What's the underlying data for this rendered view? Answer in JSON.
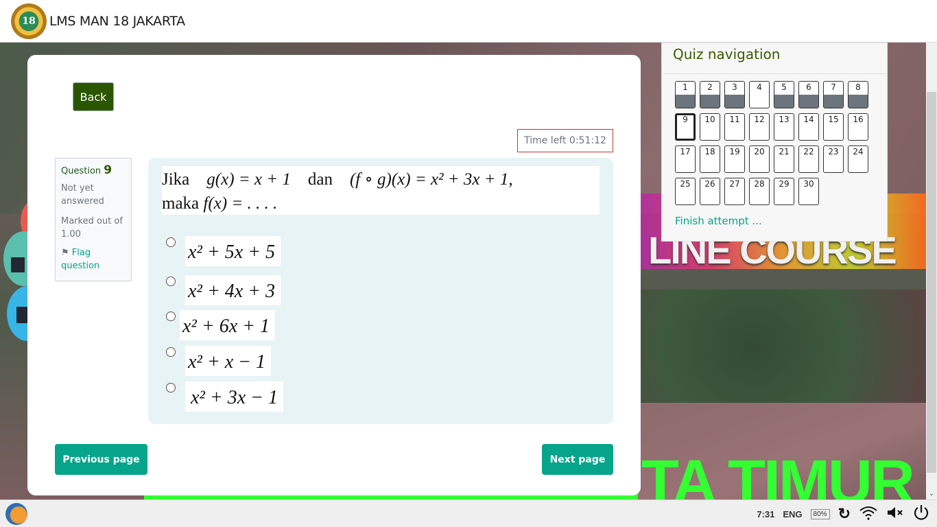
{
  "header": {
    "site_title": "LMS MAN 18 JAKARTA",
    "logo_text": "18"
  },
  "background": {
    "banner_text_course": "LINE COURSE",
    "banner_text_bottom": "TA TIMUR"
  },
  "main": {
    "back_label": "Back",
    "timer_text": "Time left 0:51:12",
    "question_info": {
      "question_label": "Question",
      "question_number": "9",
      "state": "Not yet answered",
      "grade": "Marked out of 1.00",
      "flag_label": "Flag question"
    },
    "question": {
      "line1_prefix": "Jika",
      "line1_g": "g(x) = x + 1",
      "line1_dan": "dan",
      "line1_fog": "(f ∘ g)(x) = x² + 3x + 1,",
      "line2_prefix": "maka",
      "line2_expr": "f(x) = . . . ."
    },
    "answers": [
      {
        "label": "x² + 5x + 5",
        "selected": false
      },
      {
        "label": "x² + 4x + 3",
        "selected": false
      },
      {
        "label": "x² + 6x + 1",
        "selected": false
      },
      {
        "label": "x² + x − 1",
        "selected": false
      },
      {
        "label": "x² + 3x − 1",
        "selected": false
      }
    ],
    "prev_label": "Previous page",
    "next_label": "Next page"
  },
  "quiz_nav": {
    "title": "Quiz navigation",
    "current": 9,
    "buttons": [
      {
        "n": "1",
        "answered": true
      },
      {
        "n": "2",
        "answered": true
      },
      {
        "n": "3",
        "answered": true
      },
      {
        "n": "4",
        "answered": false
      },
      {
        "n": "5",
        "answered": true
      },
      {
        "n": "6",
        "answered": true
      },
      {
        "n": "7",
        "answered": true
      },
      {
        "n": "8",
        "answered": true
      },
      {
        "n": "9",
        "answered": false
      },
      {
        "n": "10",
        "answered": false
      },
      {
        "n": "11",
        "answered": false
      },
      {
        "n": "12",
        "answered": false
      },
      {
        "n": "13",
        "answered": false
      },
      {
        "n": "14",
        "answered": false
      },
      {
        "n": "15",
        "answered": false
      },
      {
        "n": "16",
        "answered": false
      },
      {
        "n": "17",
        "answered": false
      },
      {
        "n": "18",
        "answered": false
      },
      {
        "n": "19",
        "answered": false
      },
      {
        "n": "20",
        "answered": false
      },
      {
        "n": "21",
        "answered": false
      },
      {
        "n": "22",
        "answered": false
      },
      {
        "n": "23",
        "answered": false
      },
      {
        "n": "24",
        "answered": false
      },
      {
        "n": "25",
        "answered": false
      },
      {
        "n": "26",
        "answered": false
      },
      {
        "n": "27",
        "answered": false
      },
      {
        "n": "28",
        "answered": false
      },
      {
        "n": "29",
        "answered": false
      },
      {
        "n": "30",
        "answered": false
      }
    ],
    "finish_label": "Finish attempt ..."
  },
  "taskbar": {
    "time": "7:31",
    "language": "ENG",
    "battery": "80%",
    "icons": [
      "refresh-icon",
      "wifi-icon",
      "volume-muted-icon",
      "power-icon"
    ]
  },
  "colors": {
    "accent": "#06a589",
    "back_button": "#2a5600",
    "timer_border": "#c0392b",
    "answered_fill": "#6c757d"
  }
}
